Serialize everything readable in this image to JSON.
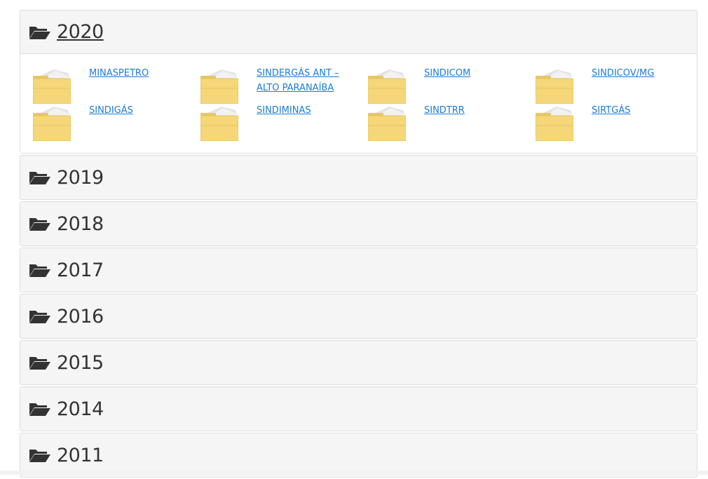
{
  "accordion": {
    "open_section": {
      "year": "2020",
      "folders": [
        {
          "label": "MINASPETRO"
        },
        {
          "label": "SINDERGÁS ANT – ALTO PARANAÍBA"
        },
        {
          "label": "SINDICOM"
        },
        {
          "label": "SINDICOV/MG"
        },
        {
          "label": "SINDIGÁS"
        },
        {
          "label": "SINDIMINAS"
        },
        {
          "label": "SINDTRR"
        },
        {
          "label": "SIRTGÁS"
        }
      ]
    },
    "collapsed_sections": [
      {
        "year": "2019"
      },
      {
        "year": "2018"
      },
      {
        "year": "2017"
      },
      {
        "year": "2016"
      },
      {
        "year": "2015"
      },
      {
        "year": "2014"
      },
      {
        "year": "2011"
      }
    ]
  },
  "icons": {
    "header_icon": "folder-open-icon",
    "item_icon": "folder-thumbnail-icon"
  },
  "colors": {
    "link": "#1a7bd6",
    "header_bg": "#f5f5f5",
    "header_text": "#333333",
    "border": "#dddddd",
    "folder_yellow": "#f5d77a"
  }
}
